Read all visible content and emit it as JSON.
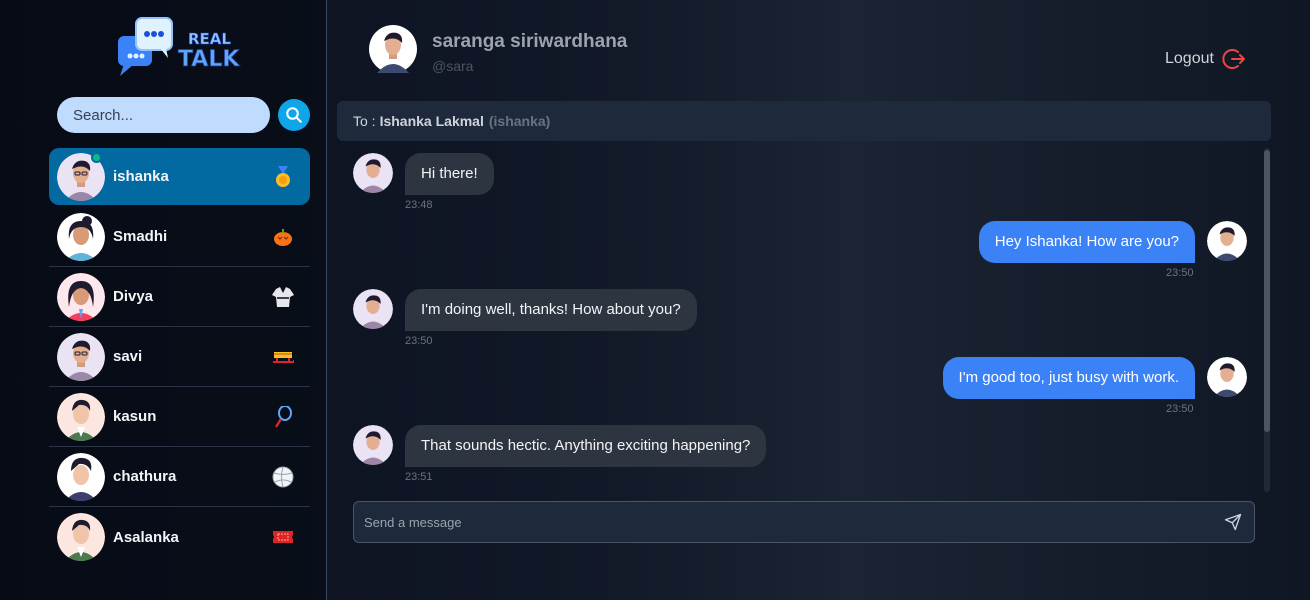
{
  "app": {
    "logo_text": "REAL TALK"
  },
  "search": {
    "placeholder": "Search..."
  },
  "contacts": [
    {
      "name": "ishanka",
      "active": true,
      "online": true,
      "emoji": "medal-icon"
    },
    {
      "name": "Smadhi",
      "active": false,
      "online": false,
      "emoji": "pumpkin-icon"
    },
    {
      "name": "Divya",
      "active": false,
      "online": false,
      "emoji": "karate-uniform-icon"
    },
    {
      "name": "savi",
      "active": false,
      "online": false,
      "emoji": "sled-icon"
    },
    {
      "name": "kasun",
      "active": false,
      "online": false,
      "emoji": "badminton-icon"
    },
    {
      "name": "chathura",
      "active": false,
      "online": false,
      "emoji": "volleyball-icon"
    },
    {
      "name": "Asalanka",
      "active": false,
      "online": false,
      "emoji": "ticket-icon"
    }
  ],
  "user": {
    "name": "saranga siriwardhana",
    "handle": "@sara"
  },
  "logout": {
    "label": "Logout"
  },
  "conversation": {
    "to_prefix": "To :",
    "to_name": "Ishanka Lakmal",
    "to_handle": "(ishanka)"
  },
  "messages": [
    {
      "text": "Hi there!",
      "time": "23:48",
      "direction": "in"
    },
    {
      "text": "Hey Ishanka! How are you?",
      "time": "23:50",
      "direction": "out"
    },
    {
      "text": "I'm doing well, thanks! How about you?",
      "time": "23:50",
      "direction": "in"
    },
    {
      "text": "I'm good too, just busy with work.",
      "time": "23:50",
      "direction": "out"
    },
    {
      "text": "That sounds hectic. Anything exciting happening?",
      "time": "23:51",
      "direction": "in"
    }
  ],
  "composer": {
    "placeholder": "Send a message"
  },
  "colors": {
    "accent": "#0ea5e9",
    "active_contact": "#0369a1",
    "outgoing_bubble": "#3b82f6",
    "incoming_bubble": "#2d3541",
    "logout_icon": "#ef4444",
    "online": "#10b981"
  }
}
